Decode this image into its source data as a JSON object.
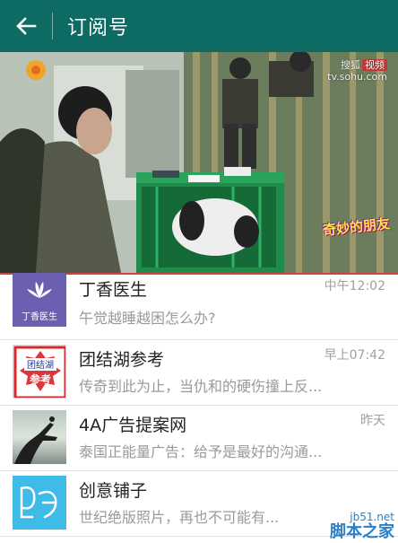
{
  "appbar": {
    "title": "订阅号",
    "background": "#0e6b64"
  },
  "banner": {
    "watermark_brand": "搜狐",
    "watermark_badge": "视频",
    "watermark_url": "tv.sohu.com",
    "show_logo": "奇妙的朋友"
  },
  "subscriptions": [
    {
      "name": "丁香医生",
      "message": "午觉越睡越困怎么办?",
      "time": "中午12:02",
      "avatar_text": "丁香医生",
      "avatar_color": "#6b5fb1"
    },
    {
      "name": "团结湖参考",
      "message": "传奇到此为止，当仇和的硬伤撞上反...",
      "time": "早上07:42",
      "avatar_text_top": "团结湖",
      "avatar_text_bottom": "参考",
      "avatar_color": "#d8262a"
    },
    {
      "name": "4A广告提案网",
      "message": "泰国正能量广告：给予是最好的沟通...",
      "time": "昨天",
      "avatar_color": "#7f8d86"
    },
    {
      "name": "创意铺子",
      "message": "世纪绝版照片，再也不可能有...",
      "time": "",
      "avatar_color": "#3ebbe6"
    }
  ],
  "site_watermark": {
    "url": "jb51.net",
    "name": "脚本之家"
  }
}
